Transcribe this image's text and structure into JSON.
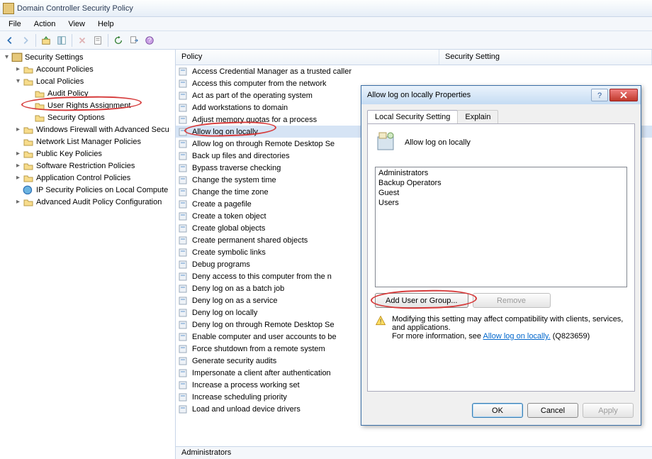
{
  "title": "Domain Controller Security Policy",
  "menu": {
    "file": "File",
    "action": "Action",
    "view": "View",
    "help": "Help"
  },
  "tree": {
    "root": "Security Settings",
    "account": "Account Policies",
    "local": "Local Policies",
    "audit": "Audit Policy",
    "ura": "User Rights Assignment",
    "secopt": "Security Options",
    "fw": "Windows Firewall with Advanced Secu",
    "nlm": "Network List Manager Policies",
    "pkp": "Public Key Policies",
    "srp": "Software Restriction Policies",
    "acp": "Application Control Policies",
    "ips": "IP Security Policies on Local Compute",
    "aap": "Advanced Audit Policy Configuration"
  },
  "cols": {
    "policy": "Policy",
    "setting": "Security Setting"
  },
  "policies": [
    "Access Credential Manager as a trusted caller",
    "Access this computer from the network",
    "Act as part of the operating system",
    "Add workstations to domain",
    "Adjust memory quotas for a process",
    "Allow log on locally",
    "Allow log on through Remote Desktop Se",
    "Back up files and directories",
    "Bypass traverse checking",
    "Change the system time",
    "Change the time zone",
    "Create a pagefile",
    "Create a token object",
    "Create global objects",
    "Create permanent shared objects",
    "Create symbolic links",
    "Debug programs",
    "Deny access to this computer from the n",
    "Deny log on as a batch job",
    "Deny log on as a service",
    "Deny log on locally",
    "Deny log on through Remote Desktop Se",
    "Enable computer and user accounts to be",
    "Force shutdown from a remote system",
    "Generate security audits",
    "Impersonate a client after authentication",
    "Increase a process working set",
    "Increase scheduling priority",
    "Load and unload device drivers"
  ],
  "selectedPolicy": 5,
  "status": "Administrators",
  "dialog": {
    "title": "Allow log on locally Properties",
    "tab1": "Local Security Setting",
    "tab2": "Explain",
    "policyName": "Allow log on locally",
    "members": [
      "Administrators",
      "Backup Operators",
      "Guest",
      "Users"
    ],
    "addBtn": "Add User or Group...",
    "removeBtn": "Remove",
    "warnText1": "Modifying this setting may affect compatibility with clients, services, and applications.",
    "warnText2": "For more information, see ",
    "warnLink": "Allow log on locally.",
    "warnKB": " (Q823659)",
    "ok": "OK",
    "cancel": "Cancel",
    "apply": "Apply"
  }
}
